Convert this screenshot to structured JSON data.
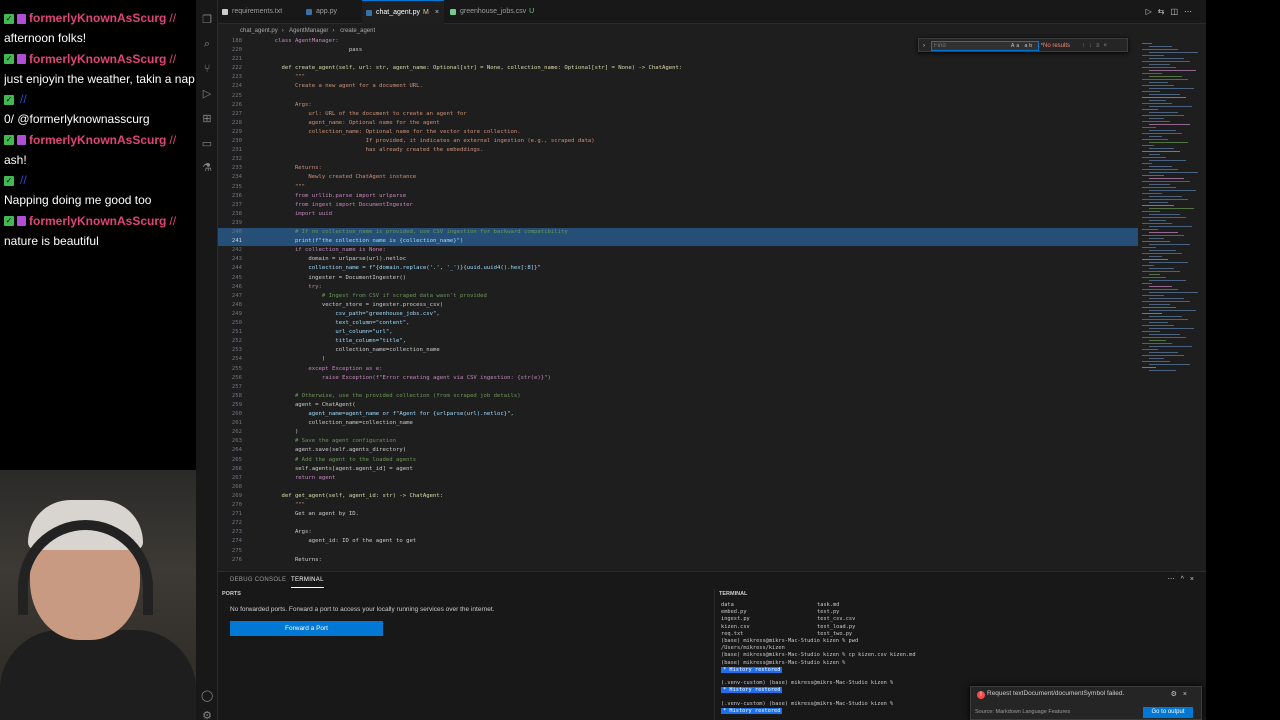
{
  "chat": {
    "messages": [
      {
        "user": "formerlyKnownAsScurg",
        "style": "primary",
        "text": "afternoon folks!"
      },
      {
        "user": "formerlyKnownAsScurg",
        "style": "primary",
        "text": "just enjoyin the weather, takin a nap a"
      },
      {
        "user": "",
        "style": "secondary",
        "text": "0/ @formerlyknownasscurg"
      },
      {
        "user": "formerlyKnownAsScurg",
        "style": "primary",
        "text": "ash!"
      },
      {
        "user": "",
        "style": "secondary",
        "text": "Napping doing me good too"
      },
      {
        "user": "formerlyKnownAsScurg",
        "style": "primary",
        "text": "nature is beautiful"
      }
    ]
  },
  "tabs": [
    {
      "label": "requirements.txt",
      "color": "#cccccc",
      "active": false,
      "modifier": ""
    },
    {
      "label": "app.py",
      "color": "#3572a5",
      "active": false,
      "modifier": ""
    },
    {
      "label": "chat_agent.py",
      "color": "#3572a5",
      "active": true,
      "modifier": "M"
    },
    {
      "label": "greenhouse_jobs.csv",
      "color": "#73c991",
      "active": false,
      "modifier": "U"
    }
  ],
  "breadcrumb": [
    "chat_agent.py",
    "AgentManager",
    "create_agent"
  ],
  "find": {
    "placeholder": "Find",
    "result": "No results"
  },
  "editor": {
    "lines": [
      {
        "n": "188",
        "t": "  class AgentManager:"
      },
      {
        "n": "220",
        "t": "                        pass"
      },
      {
        "n": "221",
        "t": ""
      },
      {
        "n": "222",
        "t": "    def create_agent(self, url: str, agent_name: Optional[str] = None, collection_name: Optional[str] = None) -> ChatAgent:"
      },
      {
        "n": "223",
        "t": "        \"\"\""
      },
      {
        "n": "224",
        "t": "        Create a new agent for a document URL."
      },
      {
        "n": "225",
        "t": ""
      },
      {
        "n": "226",
        "t": "        Args:"
      },
      {
        "n": "227",
        "t": "            url: URL of the document to create an agent for"
      },
      {
        "n": "228",
        "t": "            agent_name: Optional name for the agent"
      },
      {
        "n": "229",
        "t": "            collection_name: Optional name for the vector store collection."
      },
      {
        "n": "230",
        "t": "                             If provided, it indicates an external ingestion (e.g., scraped data)"
      },
      {
        "n": "231",
        "t": "                             has already created the embeddings."
      },
      {
        "n": "232",
        "t": ""
      },
      {
        "n": "233",
        "t": "        Returns:"
      },
      {
        "n": "234",
        "t": "            Newly created ChatAgent instance"
      },
      {
        "n": "235",
        "t": "        \"\"\""
      },
      {
        "n": "236",
        "t": "        from urllib.parse import urlparse"
      },
      {
        "n": "237",
        "t": "        from ingest import DocumentIngester"
      },
      {
        "n": "238",
        "t": "        import uuid"
      },
      {
        "n": "239",
        "t": ""
      },
      {
        "n": "240",
        "t": "        # If no collection_name is provided, use CSV ingestion for backward compatibility"
      },
      {
        "n": "241",
        "t": "        print(f\"the collection name is {collection_name}\")"
      },
      {
        "n": "242",
        "t": "        if collection_name is None:"
      },
      {
        "n": "243",
        "t": "            domain = urlparse(url).netloc"
      },
      {
        "n": "244",
        "t": "            collection_name = f\"{domain.replace('.', '_')}{uuid.uuid4().hex[:8]}\""
      },
      {
        "n": "245",
        "t": "            ingester = DocumentIngester()"
      },
      {
        "n": "246",
        "t": "            try:"
      },
      {
        "n": "247",
        "t": "                # Ingest from CSV if scraped data wasn't provided"
      },
      {
        "n": "248",
        "t": "                vector_store = ingester.process_csv("
      },
      {
        "n": "249",
        "t": "                    csv_path=\"greenhouse_jobs.csv\","
      },
      {
        "n": "250",
        "t": "                    text_column=\"content\","
      },
      {
        "n": "251",
        "t": "                    url_column=\"url\","
      },
      {
        "n": "252",
        "t": "                    title_column=\"title\","
      },
      {
        "n": "253",
        "t": "                    collection_name=collection_name"
      },
      {
        "n": "254",
        "t": "                )"
      },
      {
        "n": "255",
        "t": "            except Exception as e:"
      },
      {
        "n": "256",
        "t": "                raise Exception(f\"Error creating agent via CSV ingestion: {str(e)}\")"
      },
      {
        "n": "257",
        "t": ""
      },
      {
        "n": "258",
        "t": "        # Otherwise, use the provided collection (from scraped job details)"
      },
      {
        "n": "259",
        "t": "        agent = ChatAgent("
      },
      {
        "n": "260",
        "t": "            agent_name=agent_name or f\"Agent for {urlparse(url).netloc}\","
      },
      {
        "n": "261",
        "t": "            collection_name=collection_name"
      },
      {
        "n": "262",
        "t": "        )"
      },
      {
        "n": "263",
        "t": "        # Save the agent configuration"
      },
      {
        "n": "264",
        "t": "        agent.save(self.agents_directory)"
      },
      {
        "n": "265",
        "t": "        # Add the agent to the loaded agents"
      },
      {
        "n": "266",
        "t": "        self.agents[agent.agent_id] = agent"
      },
      {
        "n": "267",
        "t": "        return agent"
      },
      {
        "n": "268",
        "t": ""
      },
      {
        "n": "269",
        "t": "    def get_agent(self, agent_id: str) -> ChatAgent:"
      },
      {
        "n": "270",
        "t": "        \"\"\""
      },
      {
        "n": "271",
        "t": "        Get an agent by ID."
      },
      {
        "n": "272",
        "t": ""
      },
      {
        "n": "273",
        "t": "        Args:"
      },
      {
        "n": "274",
        "t": "            agent_id: ID of the agent to get"
      },
      {
        "n": "275",
        "t": ""
      },
      {
        "n": "276",
        "t": "        Returns:"
      }
    ],
    "highlight": [
      "240",
      "241"
    ],
    "cursor": "241"
  },
  "panel": {
    "tabs": [
      "DEBUG CONSOLE",
      "TERMINAL"
    ],
    "active_tab": "TERMINAL",
    "ports_header": "PORTS",
    "ports_message": "No forwarded ports. Forward a port to access your locally running services over the internet.",
    "forward_button": "Forward a Port",
    "terminal_header": "TERMINAL",
    "terminal": {
      "files": [
        [
          "data",
          "task.md"
        ],
        [
          "embed.py",
          "test.py"
        ],
        [
          "ingest.py",
          "test_csv.csv"
        ],
        [
          "kizen.csv",
          "test_load.py"
        ],
        [
          "req.txt",
          "test_two.py"
        ]
      ],
      "lines": [
        "(base) mikress@mikrs-Mac-Studio kizen % pwd",
        "/Users/mikress/kizen",
        "(base) mikress@mikrs-Mac-Studio kizen % cp kizen.csv kizen.md",
        "(base) mikress@mikrs-Mac-Studio kizen %"
      ],
      "restored": "History restored",
      "venv_prompt_1": "(.venv-custom) (base) mikress@mikrs-Mac-Studio kizen %",
      "venv_prompt_2": "(.venv-custom) (base) mikress@mikrs-Mac-Studio kizen %"
    }
  },
  "notification": {
    "message": "Request textDocument/documentSymbol failed.",
    "source": "Source: Markdown Language Features",
    "button": "Go to output"
  }
}
